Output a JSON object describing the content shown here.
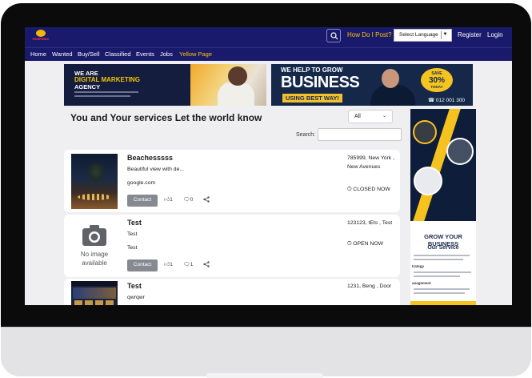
{
  "header": {
    "logo_text": "HOSPANIC",
    "how_do_i_post": "How Do I Post?",
    "language": "Select Language",
    "language_arrow": "▼",
    "register": "Register",
    "login": "Login"
  },
  "nav": {
    "items": [
      {
        "label": "Home"
      },
      {
        "label": "Wanted"
      },
      {
        "label": "Buy/Sell"
      },
      {
        "label": "Classified"
      },
      {
        "label": "Events"
      },
      {
        "label": "Jobs"
      },
      {
        "label": "Yellow Page"
      }
    ],
    "active_index": 6
  },
  "banners": {
    "left": {
      "line1": "WE ARE",
      "line2": "DIGITAL MARKETING",
      "line3": "AGENCY"
    },
    "right": {
      "line1": "WE HELP TO GROW",
      "line2": "BUSINESS",
      "line3": "USING BEST WAY!",
      "badge_top": "SAVE",
      "badge_value": "30%",
      "badge_bottom": "TODAY",
      "call": "☎ 012 001 300"
    }
  },
  "main": {
    "headline": "You and Your services Let the world know",
    "filter_value": "All",
    "search_label": "Search:",
    "search_placeholder": ""
  },
  "side_ad": {
    "title": "GROW YOUR BUSINESS",
    "subtitle": "Our Service",
    "label1": "trategy",
    "label2": "anagement"
  },
  "listings": [
    {
      "title": "Beachesssss",
      "description": "Beautiful view with de...",
      "website": "google.com",
      "contact": "Contact",
      "likes": "1",
      "comments": "0",
      "address": "785999, New York , New Avenues",
      "status": "CLOSED NOW",
      "image": "beach"
    },
    {
      "title": "Test",
      "description": "Test",
      "website": "Test",
      "contact": "Contact",
      "likes": "1",
      "comments": "1",
      "address": "123123, tEts , Test",
      "status": "OPEN NOW",
      "image": "none",
      "no_image_line1": "No image",
      "no_image_line2": "available"
    },
    {
      "title": "Test",
      "description": "qwrqwr",
      "address": "1231, Beng , Door",
      "image": "website"
    }
  ],
  "colors": {
    "header_bg": "#1a1a6c",
    "accent_yellow": "#f8c600",
    "page_bg": "#efeff1",
    "contact_button": "#858a91"
  },
  "icons": [
    "search-icon",
    "thumbs-up-icon",
    "comment-icon",
    "share-icon",
    "clock-icon",
    "camera-icon"
  ]
}
